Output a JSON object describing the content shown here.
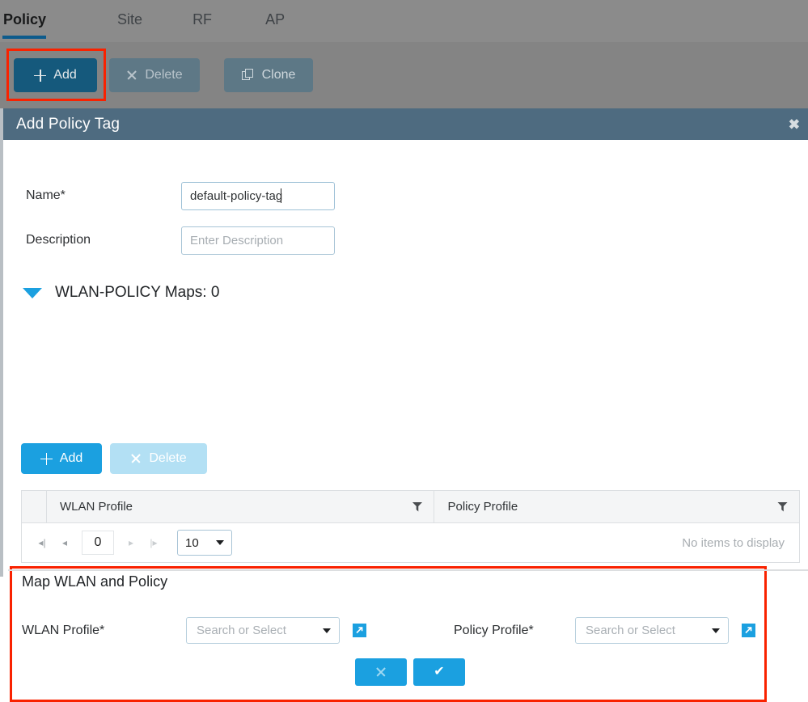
{
  "tabs": [
    {
      "label": "Policy",
      "active": true
    },
    {
      "label": "Site",
      "active": false
    },
    {
      "label": "RF",
      "active": false
    },
    {
      "label": "AP",
      "active": false
    }
  ],
  "toolbar": {
    "add_label": "Add",
    "delete_label": "Delete",
    "clone_label": "Clone"
  },
  "dialog": {
    "title": "Add Policy Tag",
    "close_glyph": "✖",
    "name_label": "Name*",
    "name_value": "default-policy-tag",
    "description_label": "Description",
    "description_placeholder": "Enter Description",
    "section_title": "WLAN-POLICY Maps: 0",
    "map_add_label": "Add",
    "map_delete_label": "Delete"
  },
  "table": {
    "columns": [
      "WLAN Profile",
      "Policy Profile"
    ],
    "rows": [],
    "empty_message": "No items to display",
    "pager": {
      "first_glyph": "⧏|",
      "prev_glyph": "◀",
      "next_glyph": "▶",
      "last_glyph": "|⧐",
      "page_value": "0",
      "page_size": "10"
    }
  },
  "map_panel": {
    "title": "Map WLAN and Policy",
    "wlan_label": "WLAN Profile*",
    "wlan_placeholder": "Search or Select",
    "policy_label": "Policy Profile*",
    "policy_placeholder": "Search or Select",
    "check_glyph": "✔"
  },
  "colors": {
    "accent_blue": "#1ba0e0",
    "dark_blue": "#15597c",
    "header_slate": "#4e6b80",
    "annotation_red": "#f92200",
    "toolbar_gray": "#848484"
  }
}
